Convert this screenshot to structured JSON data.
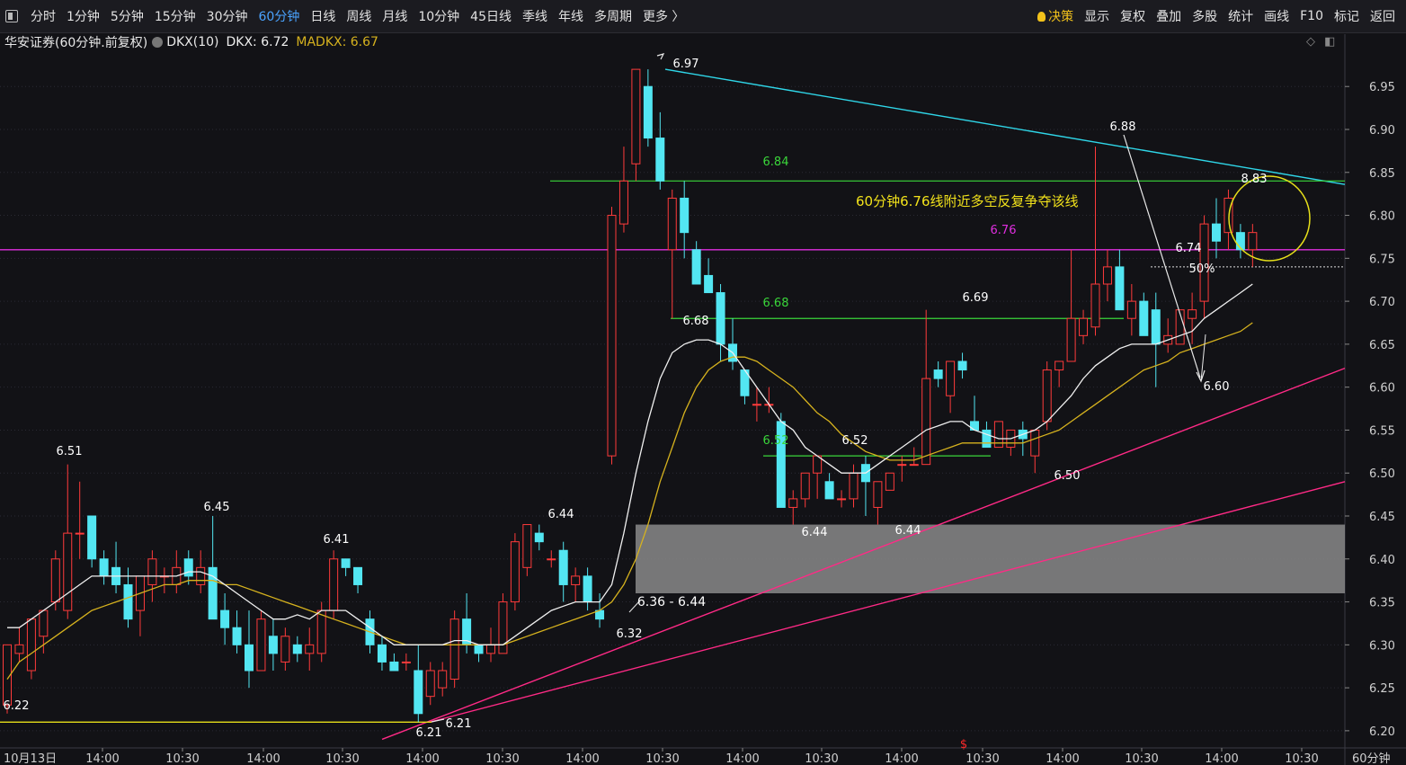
{
  "toolbar": {
    "left_items": [
      "分时",
      "1分钟",
      "5分钟",
      "15分钟",
      "30分钟",
      "60分钟",
      "日线",
      "周线",
      "月线",
      "10分钟",
      "45日线",
      "季线",
      "年线",
      "多周期",
      "更多 〉"
    ],
    "active": "60分钟",
    "right_items": [
      "决策",
      "显示",
      "复权",
      "叠加",
      "多股",
      "统计",
      "画线",
      "F10",
      "标记",
      "返回"
    ]
  },
  "info": {
    "title": "华安证券(60分钟.前复权)",
    "indicator": "DKX(10)",
    "dkx": "DKX: 6.72",
    "madkx": "MADKX: 6.67"
  },
  "colors": {
    "up": "#ff3b3b",
    "down": "#53e6f2",
    "dkx": "#f0f0f0",
    "madkx": "#d6b21e",
    "pink": "#ff2a86",
    "magenta": "#e02ee0",
    "green": "#3ad63a",
    "cyan": "#2fd6e8",
    "yellow": "#e6df1a",
    "zone": "#8a8a8a",
    "bg": "#121216"
  },
  "chart_data": {
    "type": "candlestick",
    "period": "60分钟",
    "ylim": [
      6.18,
      6.99
    ],
    "y_ticks": [
      6.2,
      6.25,
      6.3,
      6.35,
      6.4,
      6.45,
      6.5,
      6.55,
      6.6,
      6.65,
      6.7,
      6.75,
      6.8,
      6.85,
      6.9,
      6.95
    ],
    "x_labels": [
      "10月13日",
      "14:00",
      "10:30",
      "14:00",
      "10:30",
      "14:00",
      "10:30",
      "14:00",
      "10:30",
      "14:00",
      "10:30",
      "14:00",
      "10:30",
      "14:00",
      "10:30",
      "14:00",
      "10:30"
    ],
    "period_label": "60分钟",
    "candles": [
      {
        "o": 6.23,
        "h": 6.3,
        "l": 6.22,
        "c": 6.3
      },
      {
        "o": 6.29,
        "h": 6.32,
        "l": 6.28,
        "c": 6.3
      },
      {
        "o": 6.27,
        "h": 6.33,
        "l": 6.26,
        "c": 6.33
      },
      {
        "o": 6.31,
        "h": 6.34,
        "l": 6.29,
        "c": 6.34
      },
      {
        "o": 6.35,
        "h": 6.41,
        "l": 6.34,
        "c": 6.4
      },
      {
        "o": 6.34,
        "h": 6.51,
        "l": 6.33,
        "c": 6.43
      },
      {
        "o": 6.43,
        "h": 6.49,
        "l": 6.4,
        "c": 6.43
      },
      {
        "o": 6.45,
        "h": 6.45,
        "l": 6.39,
        "c": 6.4
      },
      {
        "o": 6.4,
        "h": 6.41,
        "l": 6.37,
        "c": 6.38
      },
      {
        "o": 6.39,
        "h": 6.42,
        "l": 6.36,
        "c": 6.37
      },
      {
        "o": 6.37,
        "h": 6.39,
        "l": 6.32,
        "c": 6.33
      },
      {
        "o": 6.34,
        "h": 6.38,
        "l": 6.31,
        "c": 6.38
      },
      {
        "o": 6.37,
        "h": 6.41,
        "l": 6.35,
        "c": 6.4
      },
      {
        "o": 6.38,
        "h": 6.39,
        "l": 6.36,
        "c": 6.38
      },
      {
        "o": 6.37,
        "h": 6.41,
        "l": 6.36,
        "c": 6.39
      },
      {
        "o": 6.4,
        "h": 6.41,
        "l": 6.37,
        "c": 6.38
      },
      {
        "o": 6.37,
        "h": 6.41,
        "l": 6.36,
        "c": 6.39
      },
      {
        "o": 6.39,
        "h": 6.45,
        "l": 6.33,
        "c": 6.33
      },
      {
        "o": 6.34,
        "h": 6.36,
        "l": 6.3,
        "c": 6.32
      },
      {
        "o": 6.32,
        "h": 6.34,
        "l": 6.29,
        "c": 6.3
      },
      {
        "o": 6.3,
        "h": 6.34,
        "l": 6.25,
        "c": 6.27
      },
      {
        "o": 6.27,
        "h": 6.34,
        "l": 6.27,
        "c": 6.33
      },
      {
        "o": 6.31,
        "h": 6.33,
        "l": 6.27,
        "c": 6.29
      },
      {
        "o": 6.28,
        "h": 6.32,
        "l": 6.27,
        "c": 6.31
      },
      {
        "o": 6.3,
        "h": 6.31,
        "l": 6.28,
        "c": 6.29
      },
      {
        "o": 6.29,
        "h": 6.32,
        "l": 6.27,
        "c": 6.3
      },
      {
        "o": 6.29,
        "h": 6.35,
        "l": 6.28,
        "c": 6.34
      },
      {
        "o": 6.34,
        "h": 6.41,
        "l": 6.33,
        "c": 6.4
      },
      {
        "o": 6.4,
        "h": 6.4,
        "l": 6.38,
        "c": 6.39
      },
      {
        "o": 6.39,
        "h": 6.39,
        "l": 6.36,
        "c": 6.37
      },
      {
        "o": 6.33,
        "h": 6.34,
        "l": 6.29,
        "c": 6.3
      },
      {
        "o": 6.3,
        "h": 6.31,
        "l": 6.27,
        "c": 6.28
      },
      {
        "o": 6.28,
        "h": 6.29,
        "l": 6.27,
        "c": 6.27
      },
      {
        "o": 6.28,
        "h": 6.29,
        "l": 6.27,
        "c": 6.28
      },
      {
        "o": 6.27,
        "h": 6.3,
        "l": 6.21,
        "c": 6.22
      },
      {
        "o": 6.24,
        "h": 6.28,
        "l": 6.23,
        "c": 6.27
      },
      {
        "o": 6.25,
        "h": 6.28,
        "l": 6.24,
        "c": 6.27
      },
      {
        "o": 6.26,
        "h": 6.34,
        "l": 6.25,
        "c": 6.33
      },
      {
        "o": 6.33,
        "h": 6.36,
        "l": 6.29,
        "c": 6.3
      },
      {
        "o": 6.3,
        "h": 6.3,
        "l": 6.28,
        "c": 6.29
      },
      {
        "o": 6.29,
        "h": 6.32,
        "l": 6.28,
        "c": 6.3
      },
      {
        "o": 6.29,
        "h": 6.36,
        "l": 6.29,
        "c": 6.35
      },
      {
        "o": 6.35,
        "h": 6.43,
        "l": 6.34,
        "c": 6.42
      },
      {
        "o": 6.39,
        "h": 6.44,
        "l": 6.38,
        "c": 6.44
      },
      {
        "o": 6.43,
        "h": 6.44,
        "l": 6.41,
        "c": 6.42
      },
      {
        "o": 6.4,
        "h": 6.41,
        "l": 6.39,
        "c": 6.4
      },
      {
        "o": 6.41,
        "h": 6.42,
        "l": 6.35,
        "c": 6.37
      },
      {
        "o": 6.37,
        "h": 6.39,
        "l": 6.35,
        "c": 6.38
      },
      {
        "o": 6.38,
        "h": 6.39,
        "l": 6.34,
        "c": 6.35
      },
      {
        "o": 6.34,
        "h": 6.36,
        "l": 6.32,
        "c": 6.33
      },
      {
        "o": 6.52,
        "h": 6.81,
        "l": 6.51,
        "c": 6.8
      },
      {
        "o": 6.79,
        "h": 6.88,
        "l": 6.78,
        "c": 6.84
      },
      {
        "o": 6.86,
        "h": 6.97,
        "l": 6.84,
        "c": 6.97
      },
      {
        "o": 6.95,
        "h": 6.97,
        "l": 6.88,
        "c": 6.89
      },
      {
        "o": 6.89,
        "h": 6.92,
        "l": 6.83,
        "c": 6.84
      },
      {
        "o": 6.76,
        "h": 6.83,
        "l": 6.68,
        "c": 6.82
      },
      {
        "o": 6.82,
        "h": 6.84,
        "l": 6.75,
        "c": 6.78
      },
      {
        "o": 6.76,
        "h": 6.77,
        "l": 6.72,
        "c": 6.72
      },
      {
        "o": 6.73,
        "h": 6.75,
        "l": 6.71,
        "c": 6.71
      },
      {
        "o": 6.71,
        "h": 6.72,
        "l": 6.63,
        "c": 6.65
      },
      {
        "o": 6.65,
        "h": 6.68,
        "l": 6.62,
        "c": 6.63
      },
      {
        "o": 6.62,
        "h": 6.62,
        "l": 6.58,
        "c": 6.59
      },
      {
        "o": 6.58,
        "h": 6.6,
        "l": 6.56,
        "c": 6.58
      },
      {
        "o": 6.58,
        "h": 6.6,
        "l": 6.57,
        "c": 6.58
      },
      {
        "o": 6.56,
        "h": 6.57,
        "l": 6.46,
        "c": 6.46
      },
      {
        "o": 6.46,
        "h": 6.48,
        "l": 6.44,
        "c": 6.47
      },
      {
        "o": 6.47,
        "h": 6.5,
        "l": 6.46,
        "c": 6.5
      },
      {
        "o": 6.5,
        "h": 6.52,
        "l": 6.47,
        "c": 6.52
      },
      {
        "o": 6.49,
        "h": 6.5,
        "l": 6.47,
        "c": 6.47
      },
      {
        "o": 6.47,
        "h": 6.48,
        "l": 6.46,
        "c": 6.47
      },
      {
        "o": 6.47,
        "h": 6.51,
        "l": 6.46,
        "c": 6.5
      },
      {
        "o": 6.51,
        "h": 6.52,
        "l": 6.45,
        "c": 6.49
      },
      {
        "o": 6.46,
        "h": 6.49,
        "l": 6.44,
        "c": 6.49
      },
      {
        "o": 6.48,
        "h": 6.5,
        "l": 6.48,
        "c": 6.5
      },
      {
        "o": 6.51,
        "h": 6.52,
        "l": 6.49,
        "c": 6.51
      },
      {
        "o": 6.51,
        "h": 6.53,
        "l": 6.51,
        "c": 6.51
      },
      {
        "o": 6.51,
        "h": 6.69,
        "l": 6.51,
        "c": 6.61
      },
      {
        "o": 6.62,
        "h": 6.63,
        "l": 6.6,
        "c": 6.61
      },
      {
        "o": 6.59,
        "h": 6.63,
        "l": 6.57,
        "c": 6.63
      },
      {
        "o": 6.63,
        "h": 6.64,
        "l": 6.61,
        "c": 6.62
      },
      {
        "o": 6.56,
        "h": 6.59,
        "l": 6.55,
        "c": 6.55
      },
      {
        "o": 6.55,
        "h": 6.56,
        "l": 6.53,
        "c": 6.53
      },
      {
        "o": 6.53,
        "h": 6.56,
        "l": 6.53,
        "c": 6.56
      },
      {
        "o": 6.53,
        "h": 6.55,
        "l": 6.52,
        "c": 6.55
      },
      {
        "o": 6.55,
        "h": 6.56,
        "l": 6.52,
        "c": 6.54
      },
      {
        "o": 6.52,
        "h": 6.55,
        "l": 6.5,
        "c": 6.55
      },
      {
        "o": 6.56,
        "h": 6.63,
        "l": 6.55,
        "c": 6.62
      },
      {
        "o": 6.62,
        "h": 6.63,
        "l": 6.6,
        "c": 6.63
      },
      {
        "o": 6.63,
        "h": 6.76,
        "l": 6.63,
        "c": 6.68
      },
      {
        "o": 6.66,
        "h": 6.69,
        "l": 6.65,
        "c": 6.68
      },
      {
        "o": 6.67,
        "h": 6.88,
        "l": 6.66,
        "c": 6.72
      },
      {
        "o": 6.72,
        "h": 6.76,
        "l": 6.7,
        "c": 6.74
      },
      {
        "o": 6.74,
        "h": 6.76,
        "l": 6.69,
        "c": 6.69
      },
      {
        "o": 6.68,
        "h": 6.72,
        "l": 6.66,
        "c": 6.7
      },
      {
        "o": 6.7,
        "h": 6.71,
        "l": 6.66,
        "c": 6.66
      },
      {
        "o": 6.69,
        "h": 6.71,
        "l": 6.6,
        "c": 6.65
      },
      {
        "o": 6.65,
        "h": 6.68,
        "l": 6.64,
        "c": 6.66
      },
      {
        "o": 6.65,
        "h": 6.69,
        "l": 6.65,
        "c": 6.69
      },
      {
        "o": 6.68,
        "h": 6.71,
        "l": 6.65,
        "c": 6.69
      },
      {
        "o": 6.7,
        "h": 6.8,
        "l": 6.68,
        "c": 6.79
      },
      {
        "o": 6.79,
        "h": 6.82,
        "l": 6.75,
        "c": 6.77
      },
      {
        "o": 6.78,
        "h": 6.83,
        "l": 6.76,
        "c": 6.82
      },
      {
        "o": 6.78,
        "h": 6.79,
        "l": 6.75,
        "c": 6.76
      },
      {
        "o": 6.76,
        "h": 6.79,
        "l": 6.74,
        "c": 6.78
      }
    ],
    "dkx": [
      6.32,
      6.32,
      6.33,
      6.34,
      6.35,
      6.36,
      6.37,
      6.38,
      6.38,
      6.38,
      6.38,
      6.38,
      6.38,
      6.38,
      6.38,
      6.385,
      6.385,
      6.38,
      6.37,
      6.36,
      6.35,
      6.34,
      6.33,
      6.33,
      6.335,
      6.33,
      6.34,
      6.34,
      6.34,
      6.33,
      6.32,
      6.31,
      6.3,
      6.3,
      6.3,
      6.3,
      6.3,
      6.305,
      6.305,
      6.3,
      6.3,
      6.3,
      6.31,
      6.32,
      6.33,
      6.34,
      6.345,
      6.35,
      6.35,
      6.35,
      6.37,
      6.43,
      6.5,
      6.56,
      6.61,
      6.64,
      6.65,
      6.655,
      6.655,
      6.65,
      6.64,
      6.62,
      6.6,
      6.58,
      6.56,
      6.55,
      6.53,
      6.52,
      6.51,
      6.5,
      6.5,
      6.5,
      6.51,
      6.52,
      6.53,
      6.54,
      6.55,
      6.555,
      6.56,
      6.56,
      6.55,
      6.545,
      6.54,
      6.54,
      6.545,
      6.55,
      6.56,
      6.575,
      6.59,
      6.61,
      6.625,
      6.635,
      6.645,
      6.65,
      6.65,
      6.65,
      6.655,
      6.66,
      6.665,
      6.68,
      6.69,
      6.7,
      6.71,
      6.72
    ],
    "madkx": [
      6.26,
      6.28,
      6.29,
      6.3,
      6.31,
      6.32,
      6.33,
      6.34,
      6.345,
      6.35,
      6.355,
      6.36,
      6.365,
      6.37,
      6.37,
      6.375,
      6.375,
      6.375,
      6.37,
      6.37,
      6.365,
      6.36,
      6.355,
      6.35,
      6.345,
      6.34,
      6.335,
      6.33,
      6.325,
      6.32,
      6.315,
      6.31,
      6.305,
      6.3,
      6.3,
      6.3,
      6.3,
      6.3,
      6.3,
      6.3,
      6.3,
      6.3,
      6.305,
      6.31,
      6.315,
      6.32,
      6.325,
      6.33,
      6.335,
      6.34,
      6.35,
      6.37,
      6.4,
      6.44,
      6.49,
      6.53,
      6.57,
      6.6,
      6.62,
      6.63,
      6.635,
      6.635,
      6.63,
      6.62,
      6.61,
      6.6,
      6.585,
      6.57,
      6.56,
      6.545,
      6.535,
      6.525,
      6.52,
      6.515,
      6.515,
      6.515,
      6.52,
      6.525,
      6.53,
      6.535,
      6.535,
      6.535,
      6.535,
      6.535,
      6.535,
      6.54,
      6.545,
      6.55,
      6.56,
      6.57,
      6.58,
      6.59,
      6.6,
      6.61,
      6.62,
      6.625,
      6.63,
      6.64,
      6.645,
      6.65,
      6.655,
      6.66,
      6.665,
      6.675
    ]
  },
  "annotations": {
    "price_labels": [
      "6.22",
      "6.51",
      "6.45",
      "6.41",
      "6.21",
      "6.21",
      "6.44",
      "6.32",
      "6.97",
      "6.68",
      "6.44",
      "6.52",
      "6.44",
      "6.69",
      "6.50",
      "6.88",
      "6.74",
      "6.60",
      "8.83"
    ],
    "levels": [
      {
        "label": "6.84",
        "value": 6.84
      },
      {
        "label": "6.76",
        "value": 6.76
      },
      {
        "label": "6.68",
        "value": 6.68
      },
      {
        "label": "6.52",
        "value": 6.52
      }
    ],
    "zone_label": "6.36 - 6.44",
    "zone": [
      6.36,
      6.44
    ],
    "note": "60分钟6.76线附近多空反复争夺该线",
    "pct": "50%",
    "marker": "$"
  }
}
